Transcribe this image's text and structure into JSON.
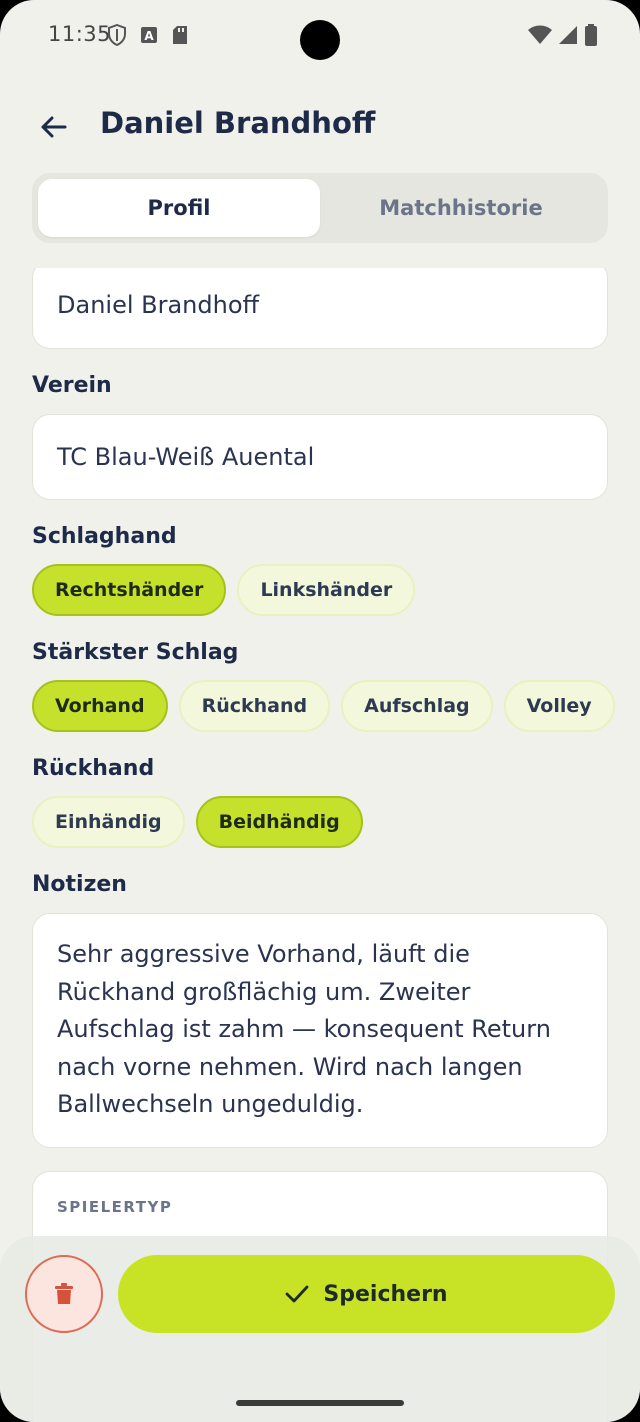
{
  "status_bar": {
    "time": "11:35",
    "icons_left": [
      "shield-icon",
      "a-badge-icon",
      "sd-card-icon"
    ],
    "icons_right": [
      "wifi-icon",
      "signal-icon",
      "battery-icon"
    ]
  },
  "app_bar": {
    "title": "Daniel Brandhoff",
    "back_icon": "arrow-left-icon"
  },
  "tabs": [
    {
      "label": "Profil",
      "active": true
    },
    {
      "label": "Matchhistorie",
      "active": false
    }
  ],
  "form": {
    "name_value": "Daniel Brandhoff",
    "club_label": "Verein",
    "club_value": "TC Blau-Weiß Auental",
    "hand_label": "Schlaghand",
    "hand_options": [
      {
        "label": "Rechtshänder",
        "selected": true
      },
      {
        "label": "Linkshänder",
        "selected": false
      }
    ],
    "stroke_label": "Stärkster Schlag",
    "stroke_options": [
      {
        "label": "Vorhand",
        "selected": true
      },
      {
        "label": "Rückhand",
        "selected": false
      },
      {
        "label": "Aufschlag",
        "selected": false
      },
      {
        "label": "Volley",
        "selected": false
      }
    ],
    "backhand_label": "Rückhand",
    "backhand_options": [
      {
        "label": "Einhändig",
        "selected": false
      },
      {
        "label": "Beidhändig",
        "selected": true
      }
    ],
    "notes_label": "Notizen",
    "notes_value": "Sehr aggressive Vorhand, läuft die Rückhand großflächig um. Zweiter Aufschlag ist zahm — konsequent Return nach vorne nehmen. Wird nach langen Ballwechseln ungeduldig.",
    "player_type_title": "SPIELERTYP"
  },
  "actions": {
    "delete_icon": "trash-icon",
    "save_icon": "check-icon",
    "save_label": "Speichern"
  },
  "colors": {
    "accent": "#c8e325",
    "chip_selected": "#c6e12b",
    "chip_unselected": "#f3f8dc",
    "danger": "#df6a55",
    "background": "#f1f1ec",
    "text_primary": "#1d2a48"
  }
}
